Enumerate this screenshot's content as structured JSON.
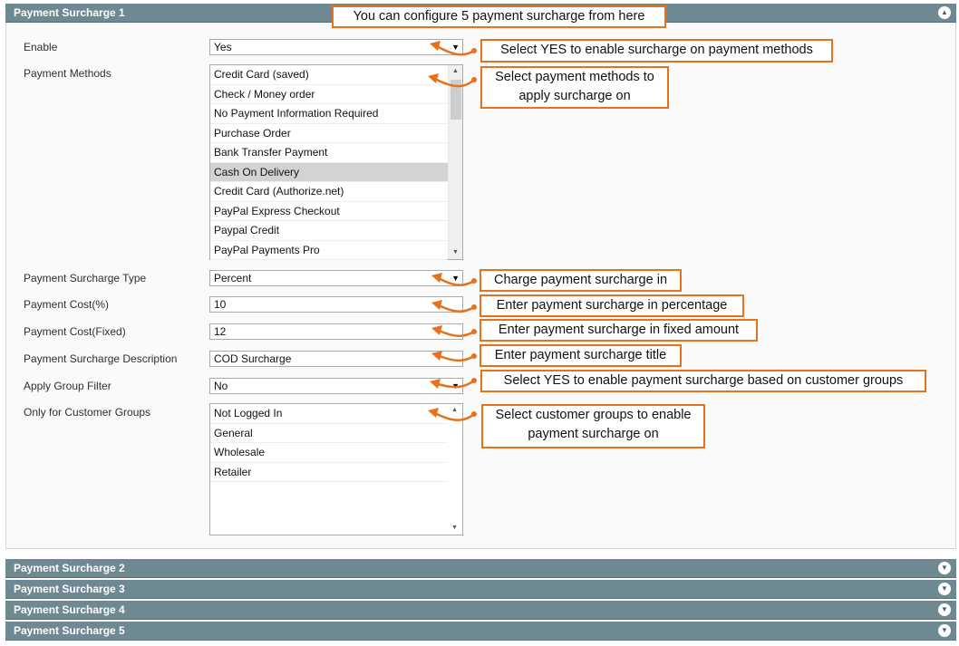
{
  "sections": [
    {
      "title": "Payment Surcharge 1",
      "expanded": true
    },
    {
      "title": "Payment Surcharge 2",
      "expanded": false
    },
    {
      "title": "Payment Surcharge 3",
      "expanded": false
    },
    {
      "title": "Payment Surcharge 4",
      "expanded": false
    },
    {
      "title": "Payment Surcharge 5",
      "expanded": false
    }
  ],
  "form": {
    "enable": {
      "label": "Enable",
      "value": "Yes"
    },
    "payment_methods": {
      "label": "Payment Methods",
      "options": [
        "Credit Card (saved)",
        "Check / Money order",
        "No Payment Information Required",
        "Purchase Order",
        "Bank Transfer Payment",
        "Cash On Delivery",
        "Credit Card (Authorize.net)",
        "PayPal Express Checkout",
        "Paypal Credit",
        "PayPal Payments Pro"
      ],
      "selected": "Cash On Delivery"
    },
    "surcharge_type": {
      "label": "Payment Surcharge Type",
      "value": "Percent"
    },
    "cost_percent": {
      "label": "Payment Cost(%)",
      "value": "10"
    },
    "cost_fixed": {
      "label": "Payment Cost(Fixed)",
      "value": "12"
    },
    "description": {
      "label": "Payment Surcharge Description",
      "value": "COD  Surcharge"
    },
    "group_filter": {
      "label": "Apply Group Filter",
      "value": "No"
    },
    "customer_groups": {
      "label": "Only for Customer Groups",
      "options": [
        "Not Logged In",
        "General",
        "Wholesale",
        "Retailer"
      ]
    }
  },
  "annotations": {
    "header": "You can configure 5 payment surcharge from here",
    "enable": "Select YES to enable surcharge on payment methods",
    "methods_line1": "Select payment methods to",
    "methods_line2": "apply surcharge on",
    "type": "Charge payment surcharge in",
    "percent": "Enter payment surcharge in percentage",
    "fixed": "Enter payment surcharge in fixed amount",
    "title": "Enter payment surcharge title",
    "group_filter": "Select YES to enable payment surcharge based on customer groups",
    "groups_line1": "Select customer groups to enable",
    "groups_line2": "payment surcharge on"
  },
  "colors": {
    "header_bg": "#6f8992",
    "annotation_border": "#e8721c",
    "selected_option_bg": "#d3d3d3"
  },
  "icons": {
    "expanded": "chevron-up-icon",
    "collapsed": "chevron-down-icon",
    "dropdown": "dropdown-arrow-icon"
  }
}
